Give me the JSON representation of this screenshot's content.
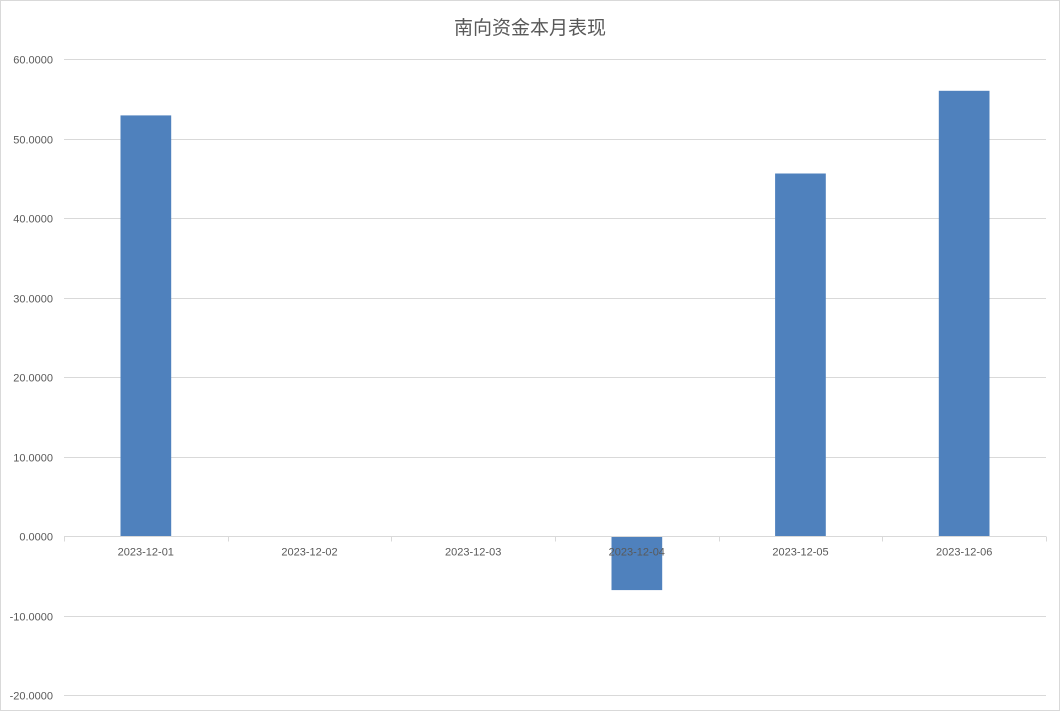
{
  "chart_data": {
    "type": "bar",
    "title": "南向资金本月表现",
    "xlabel": "",
    "ylabel": "",
    "categories": [
      "2023-12-01",
      "2023-12-02",
      "2023-12-03",
      "2023-12-04",
      "2023-12-05",
      "2023-12-06"
    ],
    "values": [
      52.9,
      0,
      0,
      -6.8,
      45.6,
      56.0
    ],
    "ylim": [
      -20,
      60
    ],
    "yticks": [
      -20,
      -10,
      0,
      10,
      20,
      30,
      40,
      50,
      60
    ],
    "ytick_labels": [
      "-20.0000",
      "-10.0000",
      "0.0000",
      "10.0000",
      "20.0000",
      "30.0000",
      "40.0000",
      "50.0000",
      "60.0000"
    ],
    "grid": true,
    "legend": "none",
    "bar_color": "#4f81bd"
  }
}
